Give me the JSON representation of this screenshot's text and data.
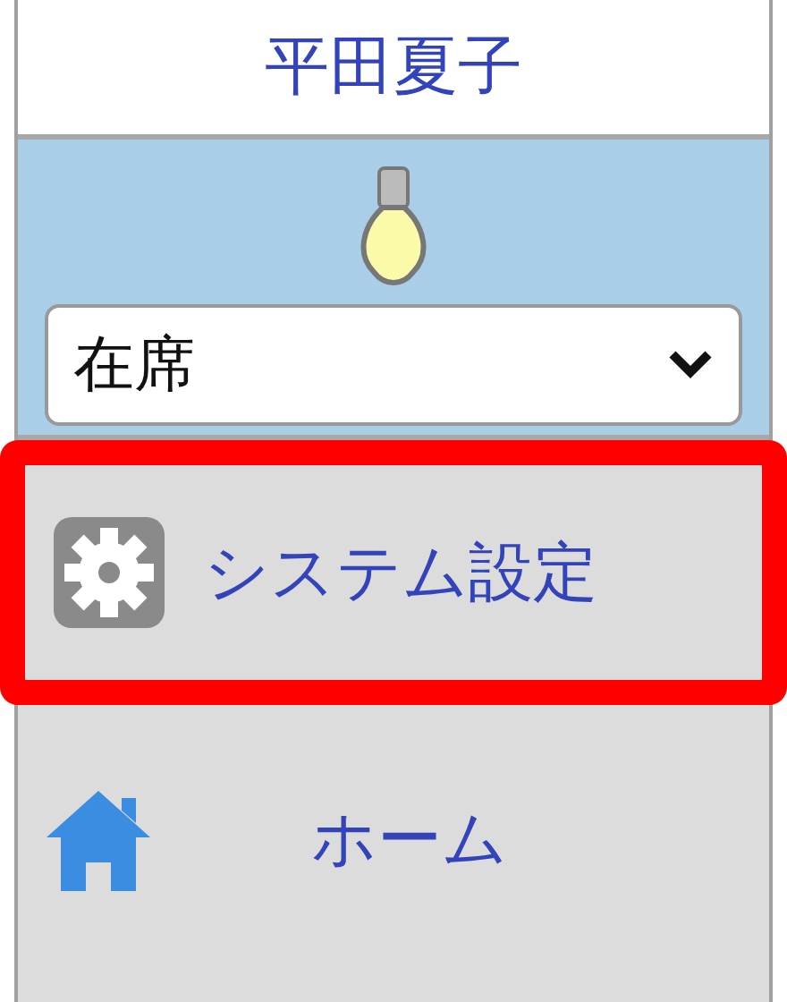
{
  "user": {
    "name": "平田夏子"
  },
  "presence": {
    "lamp_on": true,
    "status": "在席"
  },
  "menu": [
    {
      "label": "システム設定",
      "kind": "settings",
      "highlighted": true
    },
    {
      "label": "ホーム",
      "kind": "home",
      "highlighted": false
    }
  ]
}
